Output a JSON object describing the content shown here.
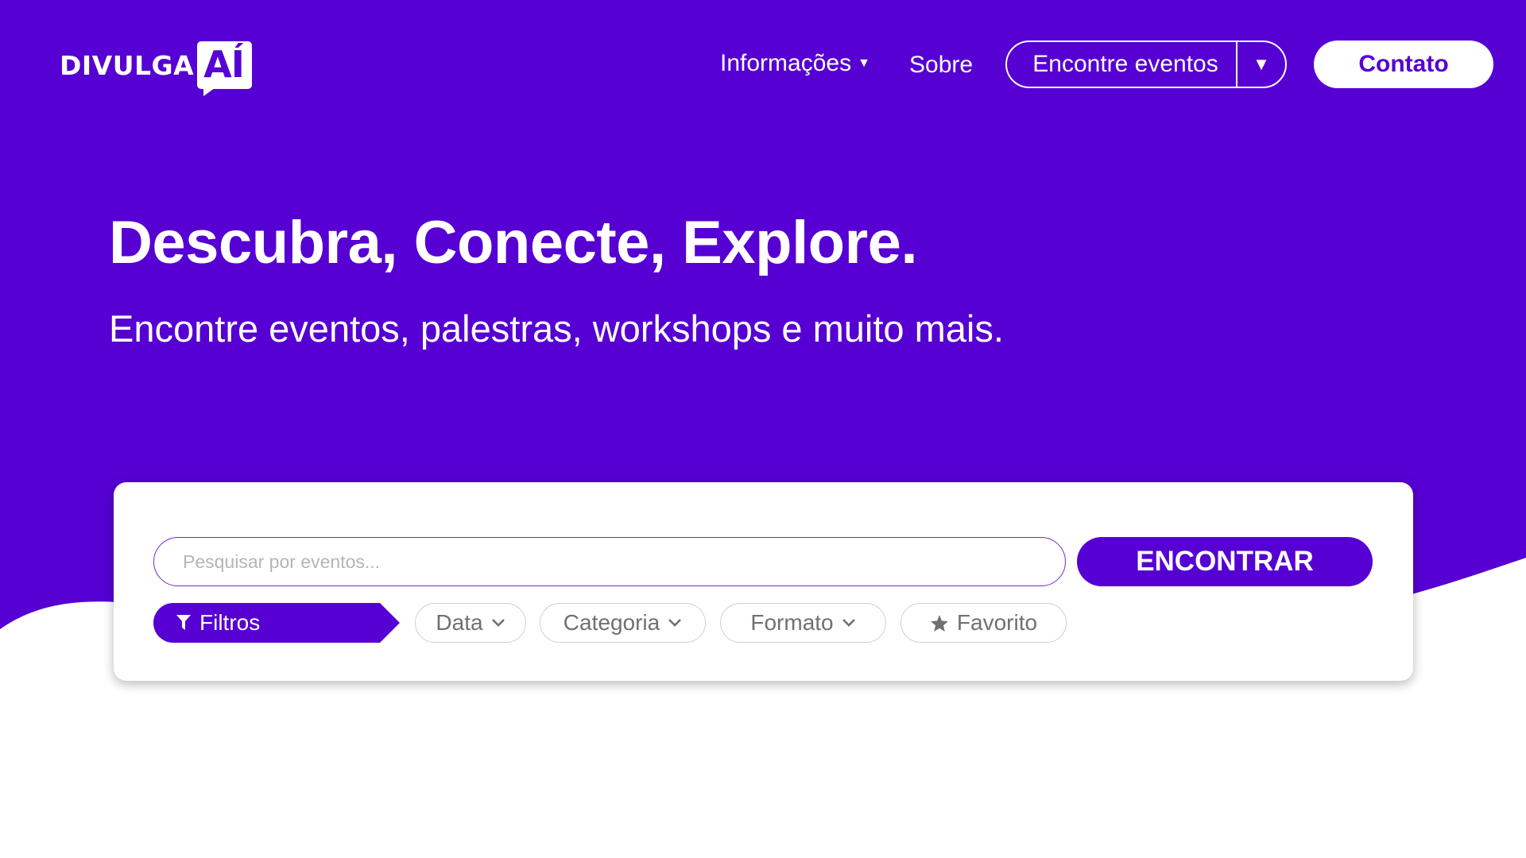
{
  "colors": {
    "brand": "#5600d3",
    "white": "#ffffff",
    "chip_border": "#cfcfcf",
    "chip_text": "#707070",
    "placeholder": "#b5b5b5"
  },
  "header": {
    "logo_text": "DIVULGA",
    "logo_badge": "AÍ",
    "nav": {
      "info_label": "Informações",
      "sobre_label": "Sobre",
      "find_events_label": "Encontre eventos",
      "contact_label": "Contato"
    }
  },
  "hero": {
    "title": "Descubra, Conecte, Explore.",
    "subtitle": "Encontre eventos, palestras, workshops e muito mais."
  },
  "search": {
    "placeholder": "Pesquisar por eventos...",
    "value": "",
    "button_label": "ENCONTRAR"
  },
  "filters": {
    "filters_label": "Filtros",
    "chips": {
      "data": "Data",
      "categoria": "Categoria",
      "formato": "Formato",
      "favorito": "Favorito"
    }
  },
  "icons": {
    "filter": "funnel-icon",
    "chevron": "chevron-down-icon",
    "star": "star-icon",
    "caret": "caret-down-icon"
  }
}
